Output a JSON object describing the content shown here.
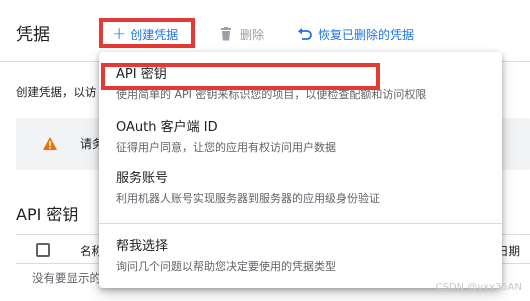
{
  "toolbar": {
    "title": "凭据",
    "create_label": "创建凭据",
    "delete_label": "删除",
    "restore_label": "恢复已删除的凭据"
  },
  "page": {
    "description_visible": "创建凭据，以访",
    "notice_text": "请务",
    "section_title": "API 密钥",
    "table_col_name": "名称",
    "table_col_date": "日期",
    "empty_text": "没有要显示的"
  },
  "menu": {
    "items": [
      {
        "title": "API 密钥",
        "subtitle": "使用简单的 API 密钥来标识您的项目，以便检查配额和访问权限"
      },
      {
        "title": "OAuth 客户端 ID",
        "subtitle": "征得用户同意，让您的应用有权访问用户数据"
      },
      {
        "title": "服务账号",
        "subtitle": "利用机器人账号实现服务器到服务器的应用级身份验证"
      },
      {
        "title": "帮我选择",
        "subtitle": "询问几个问题以帮助您决定要使用的凭据类型"
      }
    ]
  },
  "watermark": "CSDN @yxx35AN",
  "colors": {
    "accent": "#1a73e8",
    "highlight": "#e53935",
    "warning": "#e8710a"
  }
}
